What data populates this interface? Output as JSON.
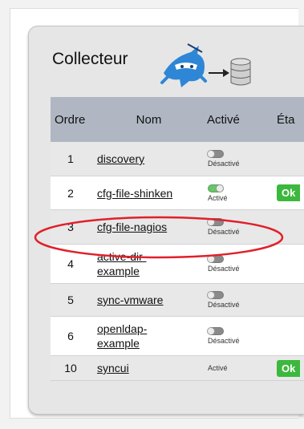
{
  "panel": {
    "title": "Collecteur",
    "icons": [
      "ninja-icon",
      "arrow-right-icon",
      "database-icon"
    ]
  },
  "table": {
    "headers": {
      "ordre": "Ordre",
      "nom": "Nom",
      "active": "Activé",
      "etat": "Éta"
    },
    "rows": [
      {
        "ordre": "1",
        "nom": "discovery",
        "enabled": false,
        "status": "Désactivé",
        "etat": ""
      },
      {
        "ordre": "2",
        "nom": "cfg-file-shinken",
        "enabled": true,
        "status": "Activé",
        "etat": "Ok"
      },
      {
        "ordre": "3",
        "nom": "cfg-file-nagios",
        "enabled": false,
        "status": "Désactivé",
        "etat": ""
      },
      {
        "ordre": "4",
        "nom": "active-dir-example",
        "enabled": false,
        "status": "Désactivé",
        "etat": ""
      },
      {
        "ordre": "5",
        "nom": "sync-vmware",
        "enabled": false,
        "status": "Désactivé",
        "etat": ""
      },
      {
        "ordre": "6",
        "nom": "openldap-example",
        "enabled": false,
        "status": "Désactivé",
        "etat": ""
      },
      {
        "ordre": "10",
        "nom": "syncui",
        "enabled": null,
        "status": "Activé",
        "etat": "Ok"
      }
    ]
  },
  "colors": {
    "header_bg": "#b0b7c3",
    "ok_green": "#3cb83c",
    "toggle_on": "#6cc36c",
    "highlight_red": "#e0202a"
  }
}
